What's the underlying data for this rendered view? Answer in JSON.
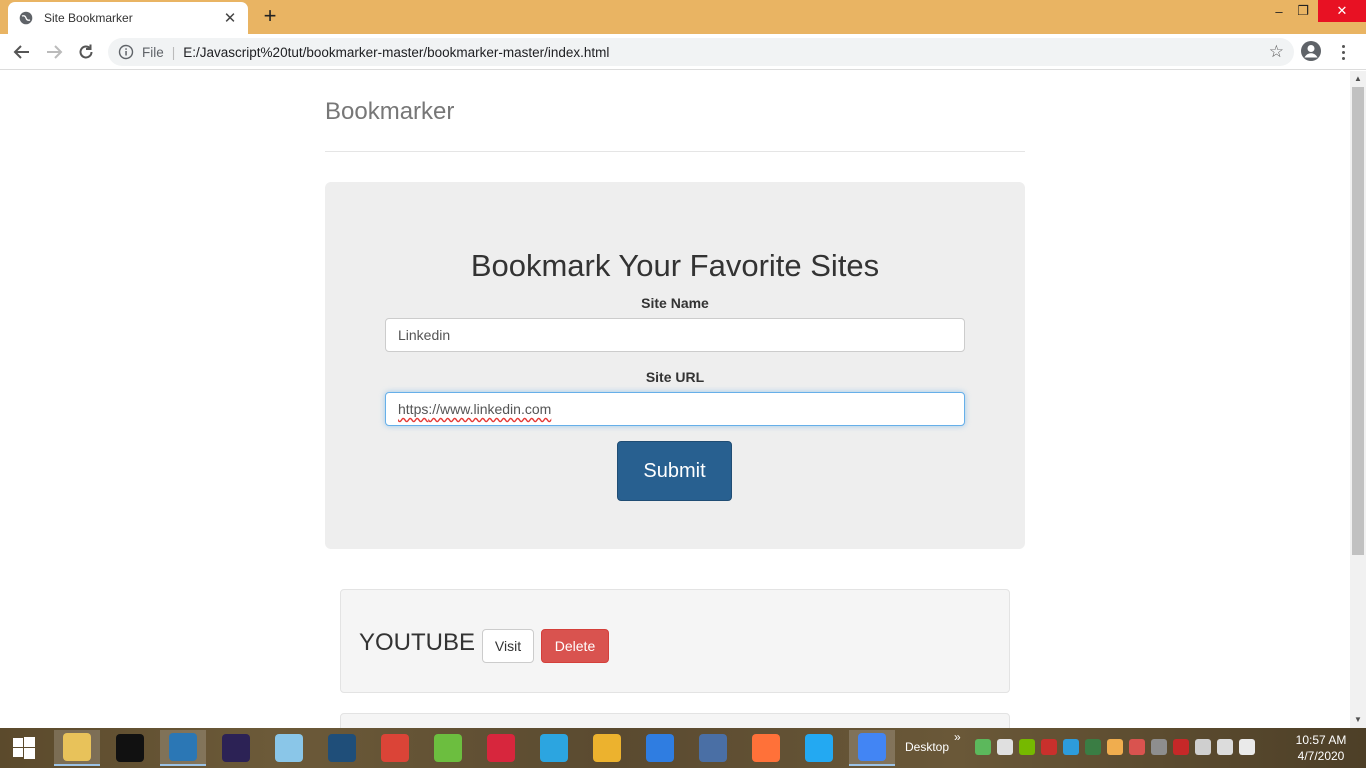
{
  "browser": {
    "tab_title": "Site Bookmarker",
    "tab_close": "✕",
    "new_tab": "+",
    "omnibox_scheme": "File",
    "omnibox_url": "E:/Javascript%20tut/bookmarker-master/bookmarker-master/index.html",
    "window_min": "–",
    "window_max": "❐",
    "window_close": "✕"
  },
  "page": {
    "brand": "Bookmarker",
    "heading": "Bookmark Your Favorite Sites",
    "site_name_label": "Site Name",
    "site_name_value": "Linkedin",
    "site_url_label": "Site URL",
    "site_url_scheme": "https",
    "site_url_rest": "://www.linkedin.com",
    "submit_label": "Submit"
  },
  "bookmarks": [
    {
      "name": "YOUTUBE",
      "visit_label": "Visit",
      "delete_label": "Delete"
    }
  ],
  "taskbar": {
    "desktop_label": "Desktop",
    "desktop_chevron": "»",
    "time": "10:57 AM",
    "date": "4/7/2020",
    "apps": [
      {
        "icon": "file-explorer-icon",
        "color": "#e8c25a"
      },
      {
        "icon": "command-prompt-icon",
        "color": "#111111"
      },
      {
        "icon": "brackets-icon",
        "color": "#2b77b5"
      },
      {
        "icon": "eclipse-icon",
        "color": "#2c2255"
      },
      {
        "icon": "notepad-icon",
        "color": "#8ac6e8"
      },
      {
        "icon": "mysql-workbench-icon",
        "color": "#1f4e79"
      },
      {
        "icon": "chrome-icon",
        "color": "#db4437"
      },
      {
        "icon": "utorrent-icon",
        "color": "#6cbe3f"
      },
      {
        "icon": "download-manager-icon",
        "color": "#d7263d"
      },
      {
        "icon": "telegram-icon",
        "color": "#2ca5e0"
      },
      {
        "icon": "slack-icon",
        "color": "#ecb22e"
      },
      {
        "icon": "shareit-icon",
        "color": "#2f7de1"
      },
      {
        "icon": "this-pc-icon",
        "color": "#4a6fa5"
      },
      {
        "icon": "firefox-icon",
        "color": "#ff7139"
      },
      {
        "icon": "vscode-icon",
        "color": "#23a9f2"
      },
      {
        "icon": "chrome-active-icon",
        "color": "#4285f4"
      }
    ]
  },
  "colors": {
    "tab_strip": "#e9b463",
    "primary_button": "#286090",
    "danger_button": "#d9534f",
    "jumbotron_bg": "#eeeeee"
  }
}
